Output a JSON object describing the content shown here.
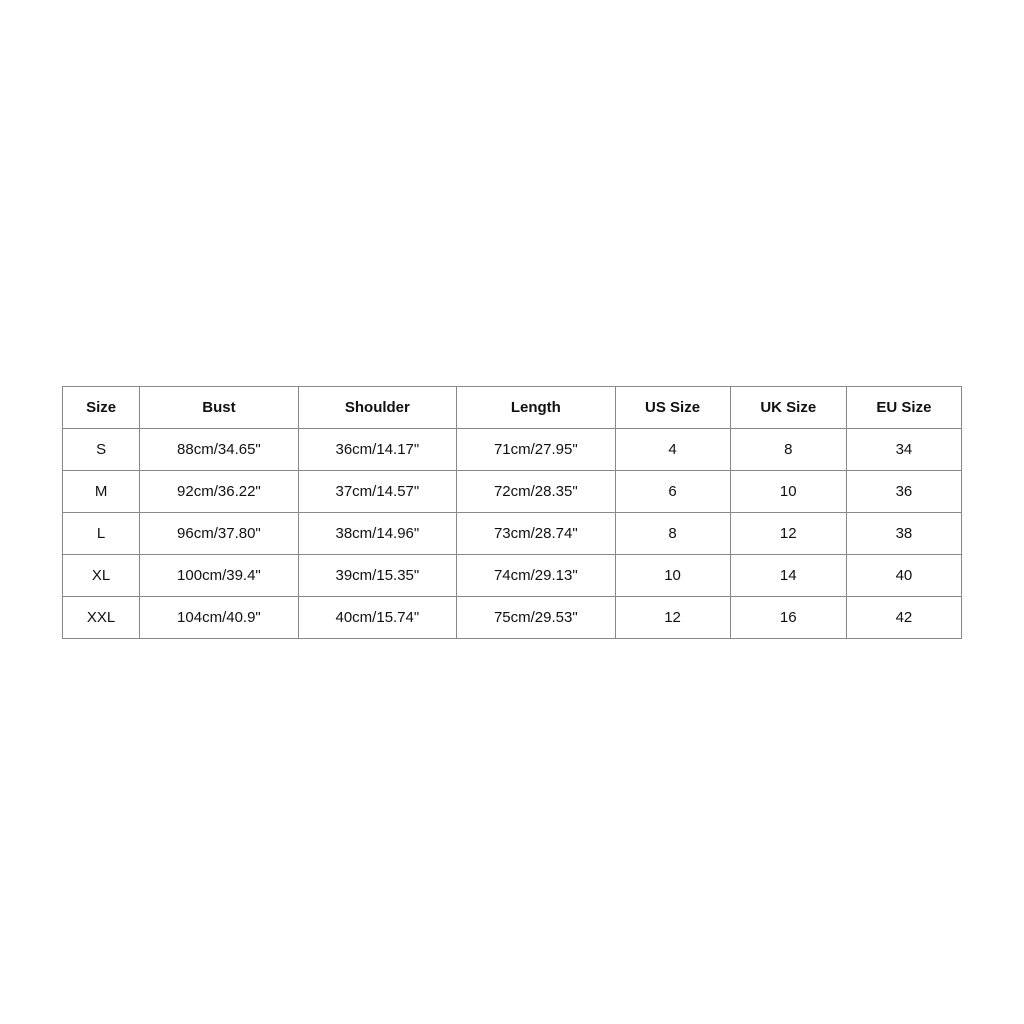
{
  "table": {
    "headers": [
      "Size",
      "Bust",
      "Shoulder",
      "Length",
      "US Size",
      "UK Size",
      "EU Size"
    ],
    "rows": [
      {
        "size": "S",
        "bust": "88cm/34.65\"",
        "shoulder": "36cm/14.17\"",
        "length": "71cm/27.95\"",
        "us_size": "4",
        "uk_size": "8",
        "eu_size": "34"
      },
      {
        "size": "M",
        "bust": "92cm/36.22\"",
        "shoulder": "37cm/14.57\"",
        "length": "72cm/28.35\"",
        "us_size": "6",
        "uk_size": "10",
        "eu_size": "36"
      },
      {
        "size": "L",
        "bust": "96cm/37.80\"",
        "shoulder": "38cm/14.96\"",
        "length": "73cm/28.74\"",
        "us_size": "8",
        "uk_size": "12",
        "eu_size": "38"
      },
      {
        "size": "XL",
        "bust": "100cm/39.4\"",
        "shoulder": "39cm/15.35\"",
        "length": "74cm/29.13\"",
        "us_size": "10",
        "uk_size": "14",
        "eu_size": "40"
      },
      {
        "size": "XXL",
        "bust": "104cm/40.9\"",
        "shoulder": "40cm/15.74\"",
        "length": "75cm/29.53\"",
        "us_size": "12",
        "uk_size": "16",
        "eu_size": "42"
      }
    ]
  }
}
